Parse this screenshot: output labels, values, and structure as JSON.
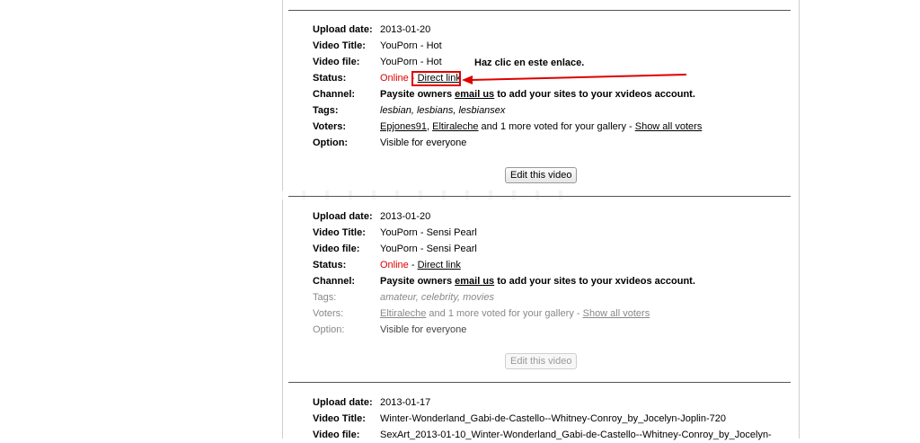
{
  "annotation": {
    "text": "Haz clic en este enlace."
  },
  "labels": {
    "upload_date": "Upload date:",
    "video_title": "Video Title:",
    "video_file": "Video file:",
    "status": "Status:",
    "channel": "Channel:",
    "tags": "Tags:",
    "voters": "Voters:",
    "option": "Option:"
  },
  "entries": [
    {
      "upload_date": "2013-01-20",
      "video_title": "YouPorn - Hot",
      "video_file": "YouPorn - Hot",
      "status_online": "Online",
      "status_sep": " - ",
      "status_link": "Direct link",
      "channel_pre": "Paysite owners ",
      "channel_link": "email us",
      "channel_post": " to add your sites to your xvideos account.",
      "tags": "lesbian, lesbians, lesbiansex",
      "voter1": "Epjones91",
      "voter_comma": ", ",
      "voter2": "Eltiraleche",
      "voters_text": " and 1 more voted for your gallery - ",
      "show_all": "Show all voters",
      "option": "Visible for everyone",
      "button": "Edit this video"
    },
    {
      "upload_date": "2013-01-20",
      "video_title": "YouPorn - Sensi Pearl",
      "video_file": "YouPorn - Sensi Pearl",
      "status_online": "Online",
      "status_sep": " - ",
      "status_link": "Direct link",
      "channel_pre": "Paysite owners ",
      "channel_link": "email us",
      "channel_post": " to add your sites to your xvideos account.",
      "tags": "amateur, celebrity, movies",
      "voter1": "Eltiraleche",
      "voters_text": " and 1 more voted for your gallery - ",
      "show_all": "Show all voters",
      "option": "Visible for everyone",
      "button": "Edit this video"
    },
    {
      "upload_date": "2013-01-17",
      "video_title": "Winter-Wonderland_Gabi-de-Castello--Whitney-Conroy_by_Jocelyn-Joplin-720",
      "video_file": "SexArt_2013-01-10_Winter-Wonderland_Gabi-de-Castello--Whitney-Conroy_by_Jocelyn-"
    }
  ]
}
